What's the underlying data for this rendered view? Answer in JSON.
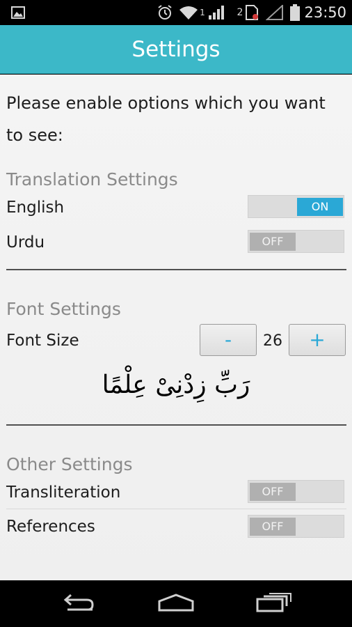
{
  "status_bar": {
    "time": "23:50",
    "sim1_label": "1",
    "sim2_label": "2",
    "icons": [
      "image-notification-icon",
      "alarm-icon",
      "wifi-icon",
      "signal-icon",
      "sim-icon",
      "signal-empty-icon",
      "battery-icon"
    ]
  },
  "app_bar": {
    "title": "Settings"
  },
  "intro_text": "Please enable options which you want to see:",
  "translation": {
    "title": "Translation Settings",
    "english": {
      "label": "English",
      "state": "ON"
    },
    "urdu": {
      "label": "Urdu",
      "state": "OFF"
    }
  },
  "font": {
    "title": "Font Settings",
    "label": "Font Size",
    "minus_label": "-",
    "plus_label": "+",
    "value": "26",
    "preview": "رَبِّ زِدْنِیْ عِلْمًا"
  },
  "other": {
    "title": "Other Settings",
    "transliteration": {
      "label": "Transliteration",
      "state": "OFF"
    },
    "references": {
      "label": "References",
      "state": "OFF"
    }
  },
  "nav_bar": {
    "icons": [
      "back-icon",
      "home-icon",
      "recents-icon"
    ]
  }
}
